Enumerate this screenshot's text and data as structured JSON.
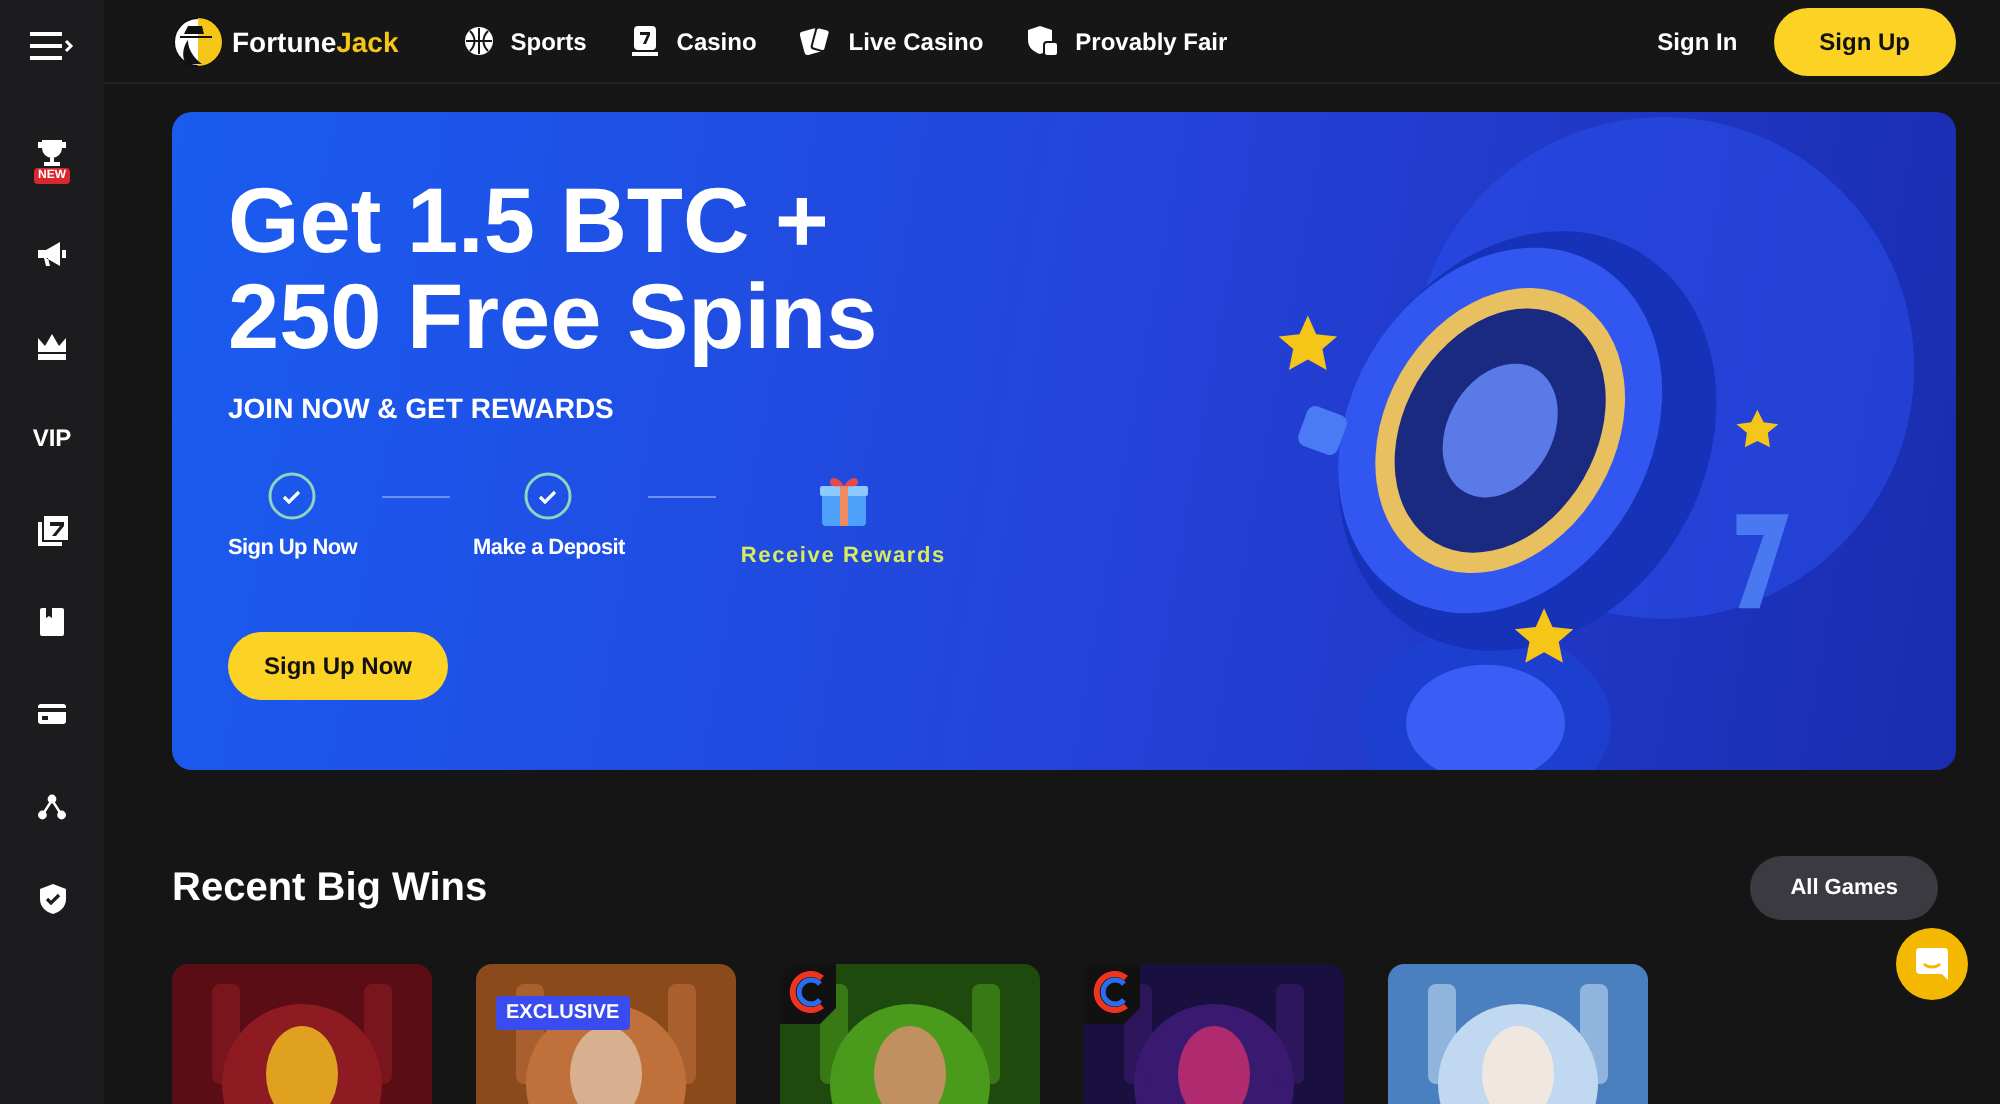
{
  "header": {
    "logo": {
      "part1": "Fortune",
      "part2": "Jack"
    },
    "nav": [
      {
        "label": "Sports"
      },
      {
        "label": "Casino"
      },
      {
        "label": "Live Casino"
      },
      {
        "label": "Provably Fair"
      }
    ],
    "sign_in": "Sign In",
    "sign_up": "Sign Up"
  },
  "sidebar": {
    "items": [
      {
        "kind": "icon",
        "badge": "NEW"
      },
      {
        "kind": "icon"
      },
      {
        "kind": "icon"
      },
      {
        "kind": "text",
        "label": "VIP"
      },
      {
        "kind": "icon"
      },
      {
        "kind": "icon"
      },
      {
        "kind": "icon"
      },
      {
        "kind": "icon"
      },
      {
        "kind": "icon"
      }
    ]
  },
  "banner": {
    "title_line1": "Get 1.5 BTC +",
    "title_line2": "250 Free Spins",
    "subtitle": "JOIN NOW & GET REWARDS",
    "steps": [
      {
        "kind": "check",
        "label": "Sign Up Now"
      },
      {
        "kind": "check",
        "label": "Make a Deposit"
      },
      {
        "kind": "gift",
        "label": "Receive Rewards"
      }
    ],
    "button": "Sign Up Now",
    "image": {
      "kind": "picture"
    }
  },
  "section": {
    "title": "Recent Big Wins",
    "button": "All Games",
    "games": [
      {
        "kind": "picture",
        "logo": false
      },
      {
        "kind": "picture",
        "badge": "EXCLUSIVE",
        "logo": false
      },
      {
        "kind": "picture",
        "logo": true
      },
      {
        "kind": "picture",
        "logo": true
      },
      {
        "kind": "picture",
        "logo": false
      }
    ]
  }
}
